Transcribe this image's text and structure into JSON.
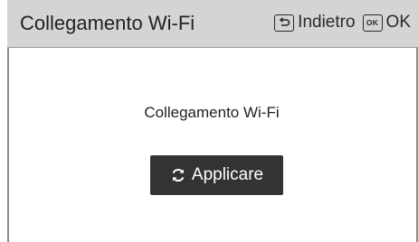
{
  "header": {
    "title": "Collegamento Wi-Fi",
    "back_label": "Indietro",
    "ok_icon_text": "OK",
    "ok_label": "OK"
  },
  "main": {
    "label": "Collegamento Wi-Fi",
    "apply_label": "Applicare"
  },
  "icons": {
    "back": "back-arrow-icon",
    "ok": "ok-key-icon",
    "apply": "refresh-icon"
  },
  "colors": {
    "header_bg": "#d4d4d4",
    "button_bg": "#333333",
    "button_text": "#ffffff"
  }
}
